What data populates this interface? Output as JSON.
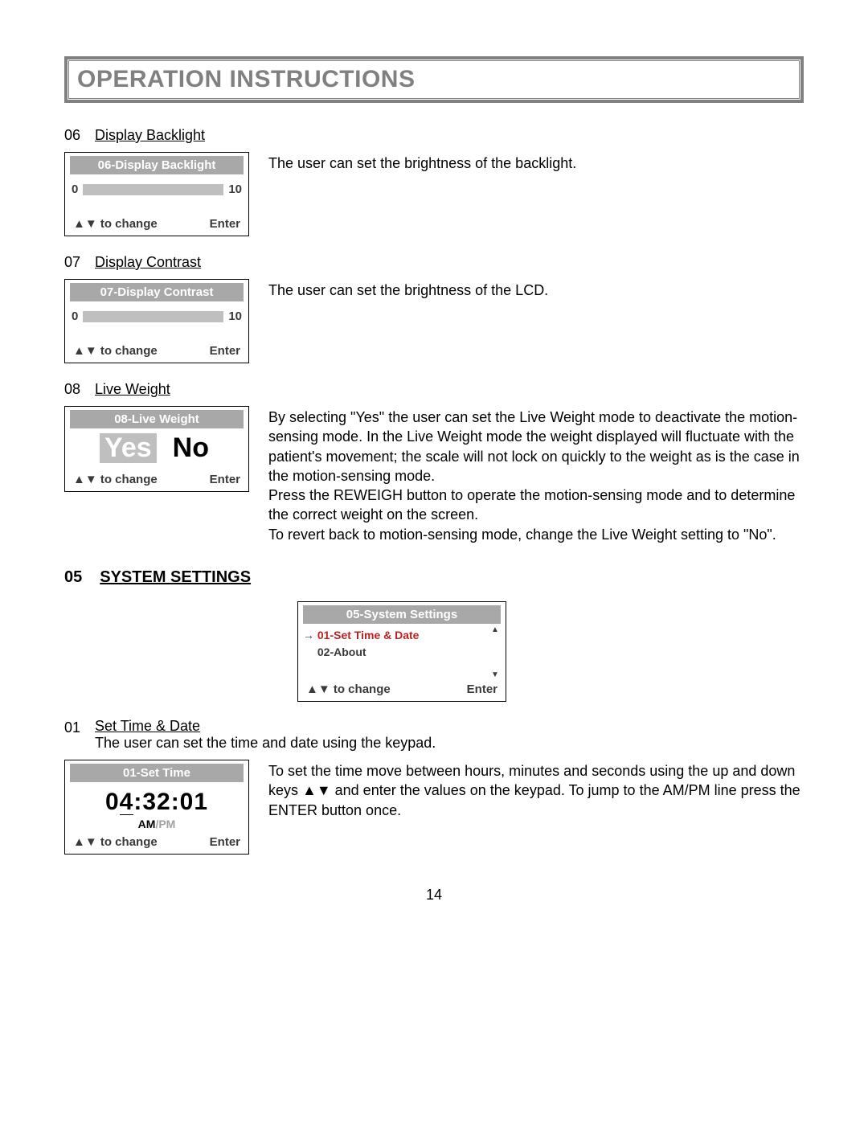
{
  "title": "OPERATION INSTRUCTIONS",
  "item06": {
    "num": "06",
    "label": "Display Backlight",
    "lcd_title": "06-Display Backlight",
    "min": "0",
    "max": "10",
    "footer_left": "▲▼ to change",
    "footer_right": "Enter",
    "desc": "The user can set the brightness of the backlight."
  },
  "item07": {
    "num": "07",
    "label": "Display Contrast",
    "lcd_title": "07-Display Contrast",
    "min": "0",
    "max": "10",
    "footer_left": "▲▼ to change",
    "footer_right": "Enter",
    "desc": "The user can set the brightness of the LCD."
  },
  "item08": {
    "num": "08",
    "label": "Live Weight",
    "lcd_title": "08-Live Weight",
    "yes": "Yes",
    "no": "No",
    "footer_left": "▲▼ to change",
    "footer_right": "Enter",
    "desc1": "By selecting \"Yes\" the user can set the Live Weight mode to deactivate the motion-sensing mode. In the Live Weight mode the weight displayed will fluctuate with the patient's movement; the scale will not lock on quickly to the weight as is the case in the motion-sensing mode.",
    "desc2": "Press the REWEIGH button to operate the motion-sensing mode and to determine the correct weight on the screen.",
    "desc3": "To revert back to motion-sensing mode, change the Live Weight setting to \"No\"."
  },
  "section05": {
    "num": "05",
    "label": "SYSTEM SETTINGS",
    "lcd_title": "05-System Settings",
    "menu1": "01-Set Time & Date",
    "menu2": "02-About",
    "footer_left": "▲▼ to change",
    "footer_right": "Enter"
  },
  "item01": {
    "num": "01",
    "label": "Set Time & Date",
    "intro": "The user can set the time and date using the keypad.",
    "lcd_title": "01-Set Time",
    "time_h": "0",
    "time_rest": ":32:01",
    "am": "AM",
    "pm": "/PM",
    "footer_left": "▲▼ to change",
    "footer_right": "Enter",
    "desc": "To set the time move between hours, minutes and seconds using the up and down keys ▲▼ and enter the values on the keypad. To jump to the AM/PM line press the ENTER button once."
  },
  "page": "14"
}
